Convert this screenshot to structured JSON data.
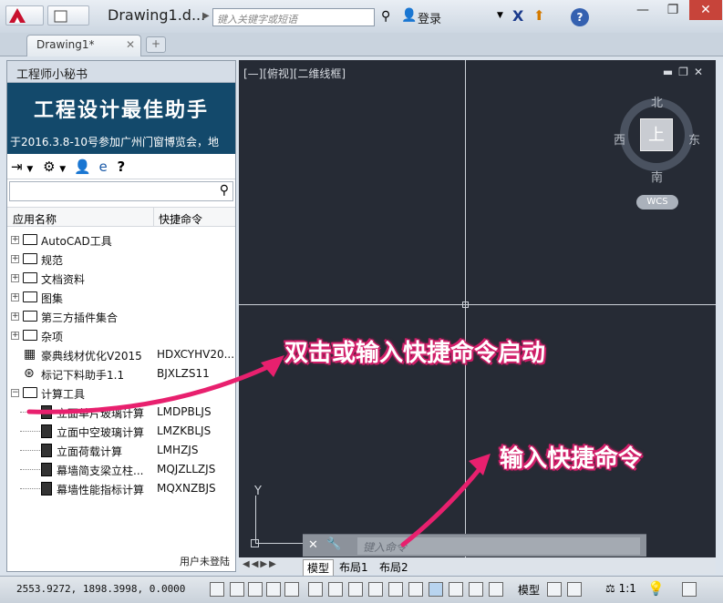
{
  "app": {
    "document_title": "Drawing1.d...",
    "search_placeholder": "键入关键字或短语",
    "login_label": "登录"
  },
  "tabs": {
    "doc_tab": "Drawing1*"
  },
  "panel": {
    "title": "工程师小秘书",
    "banner_title": "工程设计最佳助手",
    "banner_marquee": "于2016.3.8-10号参加广州门窗博览会，地",
    "col_name": "应用名称",
    "col_cmd": "快捷命令",
    "status": "用户未登陆",
    "tree": [
      {
        "label": "AutoCAD工具",
        "cmd": "",
        "type": "folder"
      },
      {
        "label": "规范",
        "cmd": "",
        "type": "folder"
      },
      {
        "label": "文档资料",
        "cmd": "",
        "type": "folder"
      },
      {
        "label": "图集",
        "cmd": "",
        "type": "folder"
      },
      {
        "label": "第三方插件集合",
        "cmd": "",
        "type": "folder"
      },
      {
        "label": "杂项",
        "cmd": "",
        "type": "folder"
      },
      {
        "label": "豪典线材优化V2015",
        "cmd": "HDXCYHV20...",
        "type": "app"
      },
      {
        "label": "标记下料助手1.1",
        "cmd": "BJXLZS11",
        "type": "app"
      },
      {
        "label": "计算工具",
        "cmd": "",
        "type": "folder-open"
      },
      {
        "label": "立面单片玻璃计算",
        "cmd": "LMDPBLJS",
        "type": "calc"
      },
      {
        "label": "立面中空玻璃计算",
        "cmd": "LMZKBLJS",
        "type": "calc"
      },
      {
        "label": "立面荷载计算",
        "cmd": "LMHZJS",
        "type": "calc"
      },
      {
        "label": "幕墙简支梁立柱...",
        "cmd": "MQJZLLZJS",
        "type": "calc"
      },
      {
        "label": "幕墙性能指标计算",
        "cmd": "MQXNZBJS",
        "type": "calc"
      }
    ]
  },
  "viewport": {
    "label": "[—][俯视][二维线框]",
    "compass_n": "北",
    "compass_s": "南",
    "compass_e": "东",
    "compass_w": "西",
    "cube_face": "上",
    "wcs": "WCS",
    "axis_y": "Y",
    "cmd_placeholder": "键入命令"
  },
  "layout_tabs": [
    "模型",
    "布局1",
    "布局2"
  ],
  "status": {
    "coords": "2553.9272, 1898.3998, 0.0000",
    "model": "模型",
    "scale": "1:1"
  },
  "callouts": {
    "c1": "双击或输入快捷命令启动",
    "c2": "输入快捷命令"
  },
  "colors": {
    "accent": "#e8206e",
    "banner": "#13496b",
    "viewport": "#262b35"
  }
}
